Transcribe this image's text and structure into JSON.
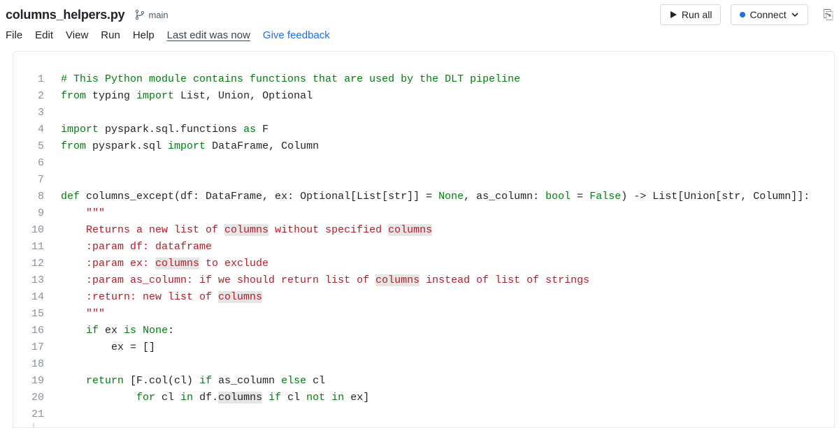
{
  "header": {
    "filename": "columns_helpers.py",
    "branch": "main",
    "run_all": "Run all",
    "connect": "Connect"
  },
  "menu": {
    "file": "File",
    "edit": "Edit",
    "view": "View",
    "run": "Run",
    "help": "Help",
    "last_edit": "Last edit was now",
    "feedback": "Give feedback"
  },
  "code": {
    "lines": [
      {
        "n": "1",
        "seg": [
          {
            "t": "# This Python module contains functions that are used by the DLT pipeline",
            "c": "c-comment"
          }
        ]
      },
      {
        "n": "2",
        "seg": [
          {
            "t": "from",
            "c": "c-kw"
          },
          {
            "t": " typing ",
            "c": "c-name"
          },
          {
            "t": "import",
            "c": "c-kw"
          },
          {
            "t": " List, Union, Optional",
            "c": "c-name"
          }
        ]
      },
      {
        "n": "3",
        "seg": [
          {
            "t": "",
            "c": "c-name"
          }
        ]
      },
      {
        "n": "4",
        "seg": [
          {
            "t": "import",
            "c": "c-kw"
          },
          {
            "t": " pyspark.sql.functions ",
            "c": "c-name"
          },
          {
            "t": "as",
            "c": "c-kw"
          },
          {
            "t": " F",
            "c": "c-name"
          }
        ]
      },
      {
        "n": "5",
        "seg": [
          {
            "t": "from",
            "c": "c-kw"
          },
          {
            "t": " pyspark.sql ",
            "c": "c-name"
          },
          {
            "t": "import",
            "c": "c-kw"
          },
          {
            "t": " DataFrame, Column",
            "c": "c-name"
          }
        ]
      },
      {
        "n": "6",
        "seg": [
          {
            "t": "",
            "c": "c-name"
          }
        ]
      },
      {
        "n": "7",
        "seg": [
          {
            "t": "",
            "c": "c-name"
          }
        ]
      },
      {
        "n": "8",
        "seg": [
          {
            "t": "def",
            "c": "c-kw"
          },
          {
            "t": " columns_except(df: DataFrame, ex: Optional[List[str]] = ",
            "c": "c-name"
          },
          {
            "t": "None",
            "c": "c-kw"
          },
          {
            "t": ", as_column: ",
            "c": "c-name"
          },
          {
            "t": "bool",
            "c": "c-kw"
          },
          {
            "t": " = ",
            "c": "c-name"
          },
          {
            "t": "False",
            "c": "c-kw"
          },
          {
            "t": ") -> List[Union[str, Column]]:",
            "c": "c-name"
          }
        ]
      },
      {
        "n": "9",
        "seg": [
          {
            "t": "    \"\"\"",
            "c": "c-str"
          }
        ]
      },
      {
        "n": "10",
        "seg": [
          {
            "t": "    Returns a new list of ",
            "c": "c-str"
          },
          {
            "t": "columns",
            "c": "c-str c-hl"
          },
          {
            "t": " without specified ",
            "c": "c-str"
          },
          {
            "t": "columns",
            "c": "c-str c-hl"
          }
        ]
      },
      {
        "n": "11",
        "seg": [
          {
            "t": "    :param df: dataframe",
            "c": "c-str"
          }
        ]
      },
      {
        "n": "12",
        "seg": [
          {
            "t": "    :param ex: ",
            "c": "c-str"
          },
          {
            "t": "columns",
            "c": "c-str c-hl"
          },
          {
            "t": " to exclude",
            "c": "c-str"
          }
        ]
      },
      {
        "n": "13",
        "seg": [
          {
            "t": "    :param as_column: if we should return list of ",
            "c": "c-str"
          },
          {
            "t": "columns",
            "c": "c-str c-hl"
          },
          {
            "t": " instead of list of strings",
            "c": "c-str"
          }
        ]
      },
      {
        "n": "14",
        "seg": [
          {
            "t": "    :return: new list of ",
            "c": "c-str"
          },
          {
            "t": "columns",
            "c": "c-str c-hl"
          }
        ]
      },
      {
        "n": "15",
        "seg": [
          {
            "t": "    \"\"\"",
            "c": "c-str"
          }
        ]
      },
      {
        "n": "16",
        "seg": [
          {
            "t": "    ",
            "c": "c-name"
          },
          {
            "t": "if",
            "c": "c-kw"
          },
          {
            "t": " ex ",
            "c": "c-name"
          },
          {
            "t": "is",
            "c": "c-kw"
          },
          {
            "t": " ",
            "c": "c-name"
          },
          {
            "t": "None",
            "c": "c-kw"
          },
          {
            "t": ":",
            "c": "c-name"
          }
        ]
      },
      {
        "n": "17",
        "seg": [
          {
            "t": "        ex = []",
            "c": "c-name"
          }
        ]
      },
      {
        "n": "18",
        "seg": [
          {
            "t": "",
            "c": "c-name"
          }
        ]
      },
      {
        "n": "19",
        "seg": [
          {
            "t": "    ",
            "c": "c-name"
          },
          {
            "t": "return",
            "c": "c-kw"
          },
          {
            "t": " [F.col(cl) ",
            "c": "c-name"
          },
          {
            "t": "if",
            "c": "c-kw"
          },
          {
            "t": " as_column ",
            "c": "c-name"
          },
          {
            "t": "else",
            "c": "c-kw"
          },
          {
            "t": " cl",
            "c": "c-name"
          }
        ]
      },
      {
        "n": "20",
        "seg": [
          {
            "t": "            ",
            "c": "c-name"
          },
          {
            "t": "for",
            "c": "c-kw"
          },
          {
            "t": " cl ",
            "c": "c-name"
          },
          {
            "t": "in",
            "c": "c-kw"
          },
          {
            "t": " df.",
            "c": "c-name"
          },
          {
            "t": "columns",
            "c": "c-name c-hl"
          },
          {
            "t": " ",
            "c": "c-name"
          },
          {
            "t": "if",
            "c": "c-kw"
          },
          {
            "t": " cl ",
            "c": "c-name"
          },
          {
            "t": "not",
            "c": "c-kw"
          },
          {
            "t": " ",
            "c": "c-name"
          },
          {
            "t": "in",
            "c": "c-kw"
          },
          {
            "t": " ex]",
            "c": "c-name"
          }
        ]
      },
      {
        "n": "21",
        "seg": [
          {
            "t": "",
            "c": "c-name"
          }
        ]
      }
    ]
  }
}
